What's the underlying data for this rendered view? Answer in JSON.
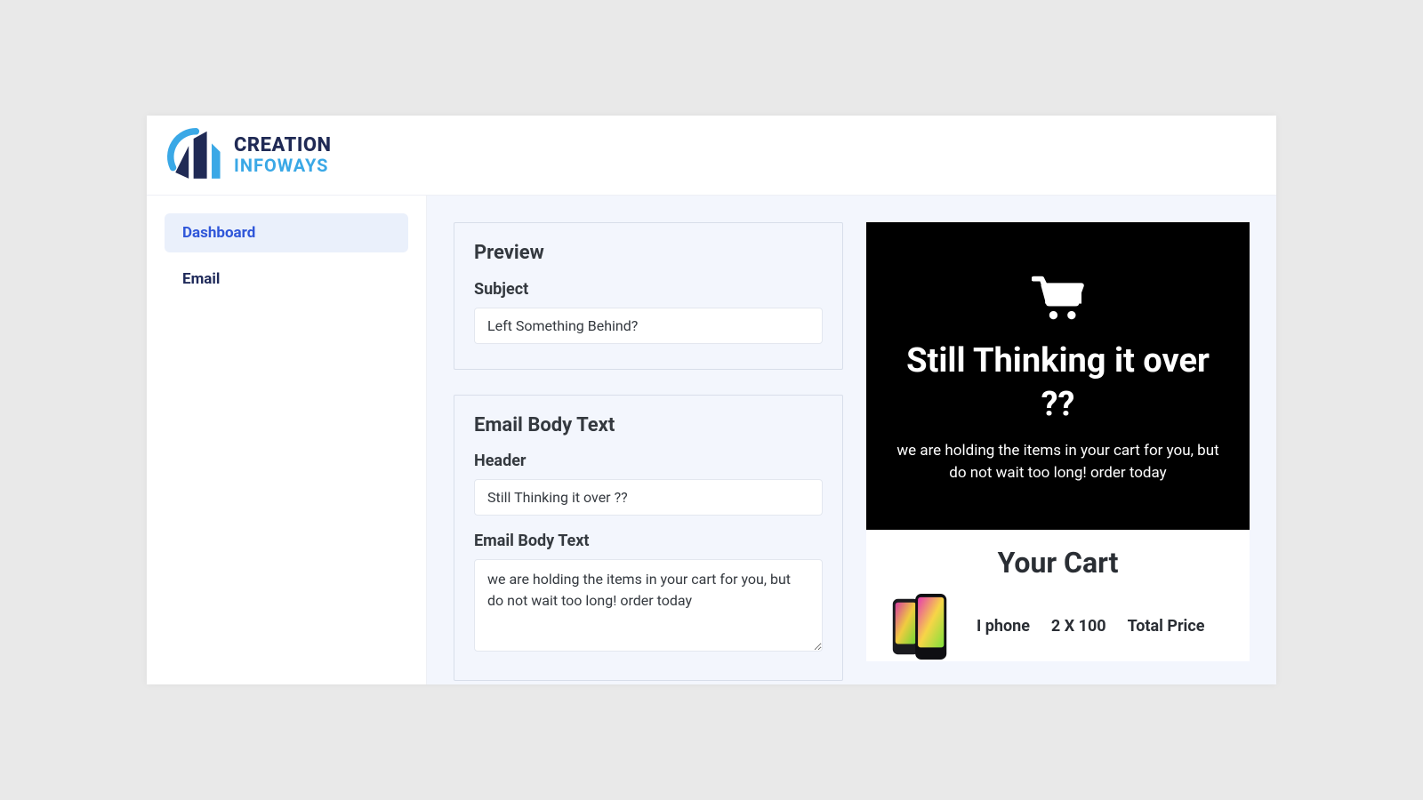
{
  "brand": {
    "line1": "CREATION",
    "line2": "INFOWAYS"
  },
  "sidebar": {
    "items": [
      {
        "label": "Dashboard",
        "active": true
      },
      {
        "label": "Email",
        "active": false
      }
    ]
  },
  "editor": {
    "preview_section": {
      "title": "Preview",
      "subject_label": "Subject",
      "subject_value": "Left Something Behind?"
    },
    "body_section": {
      "title": "Email Body Text",
      "header_label": "Header",
      "header_value": "Still Thinking it over ??",
      "body_label": "Email Body Text",
      "body_value": "we are holding the items in your cart for you, but do not wait too long! order today"
    }
  },
  "preview": {
    "hero_title": "Still Thinking it over ??",
    "hero_sub": "we are holding the items in your cart for you, but do not wait too long! order today",
    "cart_heading": "Your Cart",
    "cart_item": {
      "name": "I phone",
      "qty_price": "2 X 100",
      "total_label": "Total Price"
    }
  }
}
